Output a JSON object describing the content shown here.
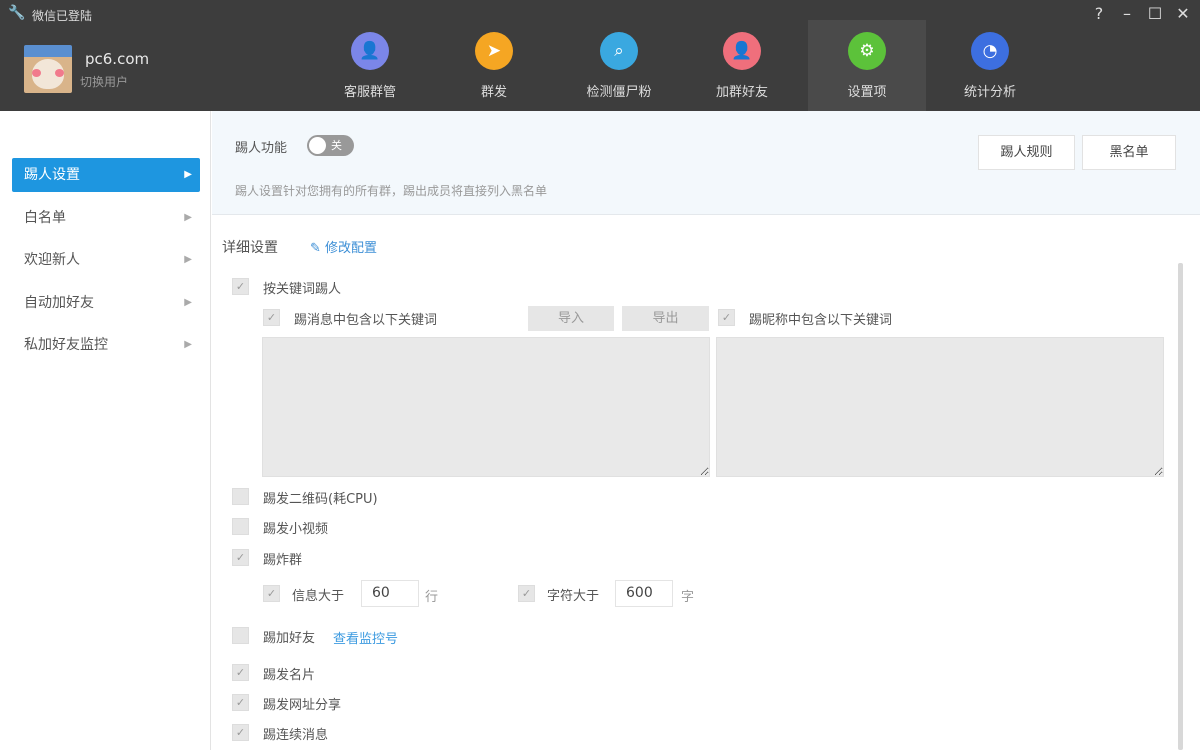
{
  "window": {
    "title": "微信已登陆",
    "controls": [
      "?",
      "–",
      "☐",
      "✕"
    ]
  },
  "user": {
    "name": "pc6.com",
    "switch_label": "切换用户"
  },
  "nav": [
    {
      "label": "客服群管",
      "color": "#7b86e8",
      "icon": "👤"
    },
    {
      "label": "群发",
      "color": "#f5a623",
      "icon": "➤"
    },
    {
      "label": "检测僵尸粉",
      "color": "#3aa8e0",
      "icon": "⌕"
    },
    {
      "label": "加群好友",
      "color": "#ef6f7c",
      "icon": "👤"
    },
    {
      "label": "设置项",
      "color": "#5cc23a",
      "icon": "⚙",
      "active": true
    },
    {
      "label": "统计分析",
      "color": "#3d6fe0",
      "icon": "◔"
    }
  ],
  "sidebar": [
    {
      "label": "踢人设置",
      "active": true
    },
    {
      "label": "白名单"
    },
    {
      "label": "欢迎新人"
    },
    {
      "label": "自动加好友"
    },
    {
      "label": "私加好友监控"
    }
  ],
  "panel": {
    "kick_label": "踢人功能",
    "toggle": "关",
    "toggle_on": false,
    "desc": "踢人设置针对您拥有的所有群，踢出成员将直接列入黑名单",
    "rules_btn": "踢人规则",
    "blacklist_btn": "黑名单"
  },
  "detail": {
    "title": "详细设置",
    "edit": "修改配置",
    "keyword": {
      "label": "按关键词踢人",
      "checked": true,
      "msg_label": "踢消息中包含以下关键词",
      "msg_checked": true,
      "import": "导入",
      "export": "导出",
      "nick_label": "踢昵称中包含以下关键词",
      "nick_checked": true
    },
    "qr": {
      "label": "踢发二维码(耗CPU)",
      "checked": false
    },
    "video": {
      "label": "踢发小视频",
      "checked": false
    },
    "bomb": {
      "label": "踢炸群",
      "checked": true,
      "msg_gt": "信息大于",
      "msg_val": "60",
      "msg_unit": "行",
      "char_gt": "字符大于",
      "char_val": "600",
      "char_unit": "字"
    },
    "addfriend": {
      "label": "踢加好友",
      "checked": false,
      "link": "查看监控号"
    },
    "card": {
      "label": "踢发名片",
      "checked": true
    },
    "url": {
      "label": "踢发网址分享",
      "checked": true
    },
    "cont": {
      "label": "踢连续消息",
      "checked": true
    }
  }
}
